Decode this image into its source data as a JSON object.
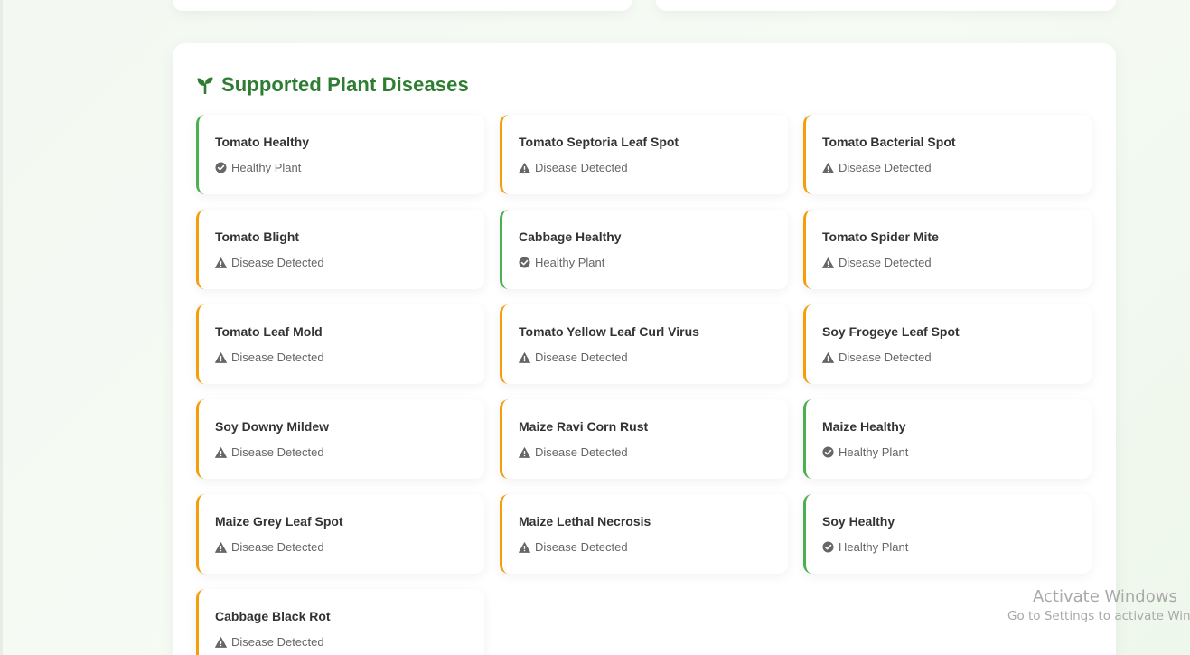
{
  "section": {
    "title": "Supported Plant Diseases",
    "icon": "seedling-icon",
    "title_color": "#2e7d32"
  },
  "status_types": {
    "healthy": {
      "label": "Healthy Plant",
      "icon": "check-circle-icon",
      "color": "#4caf50"
    },
    "disease": {
      "label": "Disease Detected",
      "icon": "warning-triangle-icon",
      "color": "#f59e0b"
    }
  },
  "diseases": [
    {
      "name": "Tomato Healthy",
      "status": "Healthy Plant",
      "type": "healthy"
    },
    {
      "name": "Tomato Septoria Leaf Spot",
      "status": "Disease Detected",
      "type": "disease"
    },
    {
      "name": "Tomato Bacterial Spot",
      "status": "Disease Detected",
      "type": "disease"
    },
    {
      "name": "Tomato Blight",
      "status": "Disease Detected",
      "type": "disease"
    },
    {
      "name": "Cabbage Healthy",
      "status": "Healthy Plant",
      "type": "healthy"
    },
    {
      "name": "Tomato Spider Mite",
      "status": "Disease Detected",
      "type": "disease"
    },
    {
      "name": "Tomato Leaf Mold",
      "status": "Disease Detected",
      "type": "disease"
    },
    {
      "name": "Tomato Yellow Leaf Curl Virus",
      "status": "Disease Detected",
      "type": "disease"
    },
    {
      "name": "Soy Frogeye Leaf Spot",
      "status": "Disease Detected",
      "type": "disease"
    },
    {
      "name": "Soy Downy Mildew",
      "status": "Disease Detected",
      "type": "disease"
    },
    {
      "name": "Maize Ravi Corn Rust",
      "status": "Disease Detected",
      "type": "disease"
    },
    {
      "name": "Maize Healthy",
      "status": "Healthy Plant",
      "type": "healthy"
    },
    {
      "name": "Maize Grey Leaf Spot",
      "status": "Disease Detected",
      "type": "disease"
    },
    {
      "name": "Maize Lethal Necrosis",
      "status": "Disease Detected",
      "type": "disease"
    },
    {
      "name": "Soy Healthy",
      "status": "Healthy Plant",
      "type": "healthy"
    },
    {
      "name": "Cabbage Black Rot",
      "status": "Disease Detected",
      "type": "disease"
    }
  ],
  "watermark": {
    "title": "Activate Windows",
    "subtitle": "Go to Settings to activate Windows."
  }
}
